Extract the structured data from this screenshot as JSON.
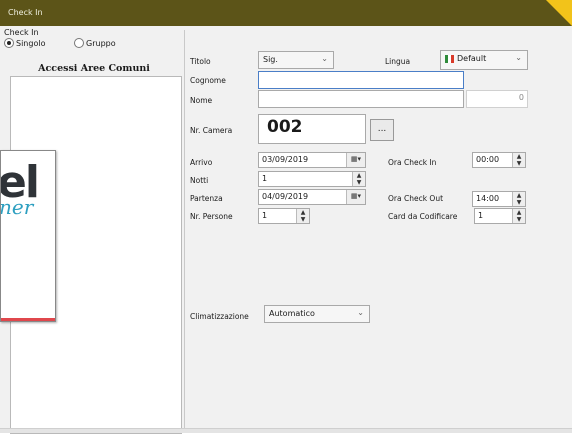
{
  "window": {
    "title": "Check In"
  },
  "left": {
    "group_label": "Check In",
    "radio_singolo": "Singolo",
    "radio_gruppo": "Gruppo",
    "areas_title": "Accessi Aree Comuni"
  },
  "form": {
    "titolo": {
      "label": "Titolo",
      "value": "Sig."
    },
    "lingua": {
      "label": "Lingua",
      "value": "Default",
      "flag_icon": "italy-flag-icon"
    },
    "cognome": {
      "label": "Cognome",
      "value": ""
    },
    "nome": {
      "label": "Nome",
      "value": "",
      "counter": "0"
    },
    "camera": {
      "label": "Nr. Camera",
      "value": "002",
      "lookup_label": "..."
    },
    "arrivo": {
      "label": "Arrivo",
      "value": "03/09/2019"
    },
    "checkin": {
      "label": "Ora Check In",
      "value": "00:00"
    },
    "notti": {
      "label": "Notti",
      "value": "1"
    },
    "partenza": {
      "label": "Partenza",
      "value": "04/09/2019"
    },
    "checkout": {
      "label": "Ora Check Out",
      "value": "14:00"
    },
    "persone": {
      "label": "Nr. Persone",
      "value": "1"
    },
    "card": {
      "label": "Card da Codificare",
      "value": "1"
    },
    "clima": {
      "label": "Climatizzazione",
      "value": "Automatico"
    }
  },
  "overlay": {
    "big_text": "el",
    "script_text": "ner"
  },
  "colors": {
    "titlebar": "#5c5418",
    "accent_corner": "#f2c31a",
    "focus": "#4a7ec7"
  }
}
